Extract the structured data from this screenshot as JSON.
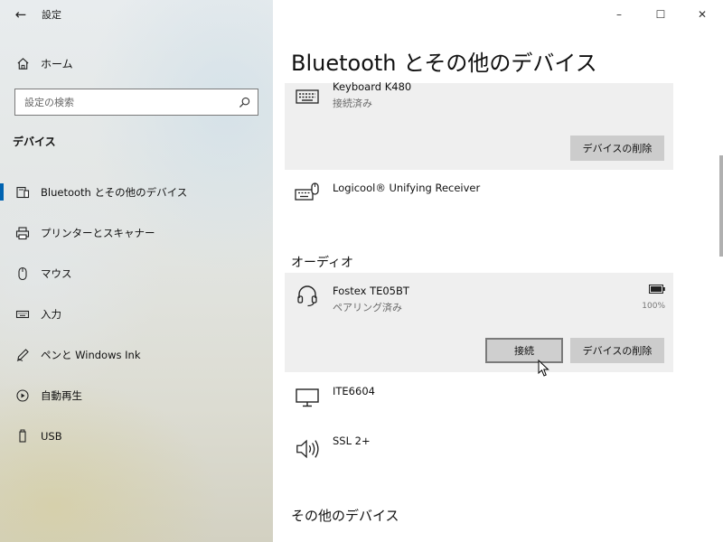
{
  "window": {
    "back_glyph": "←",
    "title": "設定",
    "controls": {
      "minimize": "–",
      "maximize": "☐",
      "close": "✕"
    }
  },
  "sidebar": {
    "home": {
      "label": "ホーム",
      "icon": "home-icon"
    },
    "search": {
      "placeholder": "設定の検索",
      "value": "",
      "icon": "search-icon"
    },
    "section_title": "デバイス",
    "items": [
      {
        "label": "Bluetooth とその他のデバイス",
        "icon": "bluetooth-devices-icon",
        "selected": true
      },
      {
        "label": "プリンターとスキャナー",
        "icon": "printer-icon"
      },
      {
        "label": "マウス",
        "icon": "mouse-icon"
      },
      {
        "label": "入力",
        "icon": "keyboard-icon"
      },
      {
        "label": "ペンと Windows Ink",
        "icon": "pen-icon"
      },
      {
        "label": "自動再生",
        "icon": "autoplay-icon"
      },
      {
        "label": "USB",
        "icon": "usb-icon"
      }
    ]
  },
  "main": {
    "title": "Bluetooth とその他のデバイス",
    "accent_color": "#0063b1",
    "devices_top": [
      {
        "name": "Keyboard K480",
        "status": "接続済み",
        "icon": "keyboard-icon",
        "actions": {
          "remove_label": "デバイスの削除"
        }
      },
      {
        "name": "Logicool® Unifying Receiver",
        "icon": "keyboard-mouse-icon"
      }
    ],
    "audio_group": {
      "title": "オーディオ",
      "devices": [
        {
          "name": "Fostex TE05BT",
          "status": "ペアリング済み",
          "icon": "headset-icon",
          "battery": {
            "percent": 100,
            "label": "100%",
            "icon": "battery-icon"
          },
          "actions": {
            "connect_label": "接続",
            "remove_label": "デバイスの削除"
          }
        },
        {
          "name": "ITE6604",
          "icon": "monitor-icon"
        },
        {
          "name": "SSL 2+",
          "icon": "speaker-icon"
        }
      ]
    },
    "other_group": {
      "title": "その他のデバイス"
    }
  }
}
